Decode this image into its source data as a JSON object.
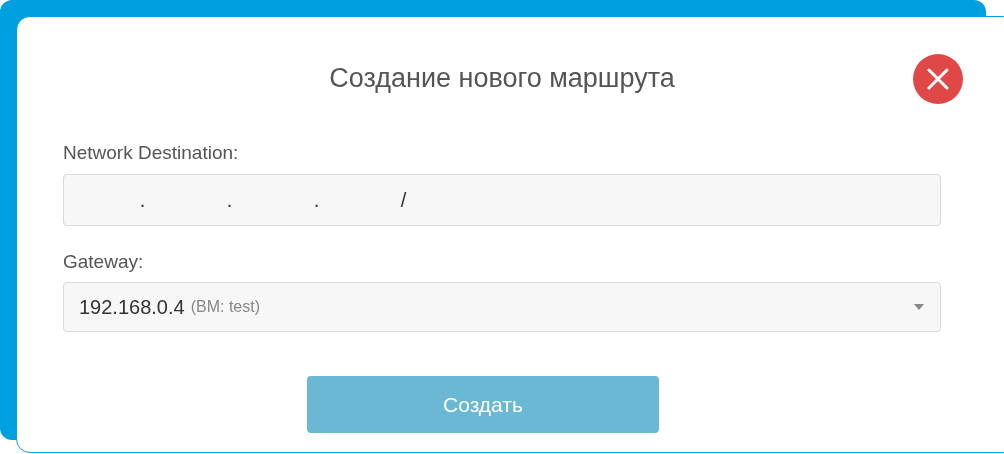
{
  "dialog": {
    "title": "Создание нового маршрута"
  },
  "fields": [
    {
      "kind": "ip",
      "label": "Network Destination:",
      "separators": [
        ".",
        ".",
        ".",
        "/"
      ]
    },
    {
      "kind": "select",
      "label": "Gateway:",
      "value": "192.168.0.4",
      "note": "(BM: test)"
    }
  ],
  "submit": {
    "label": "Создать",
    "disabled": true
  }
}
